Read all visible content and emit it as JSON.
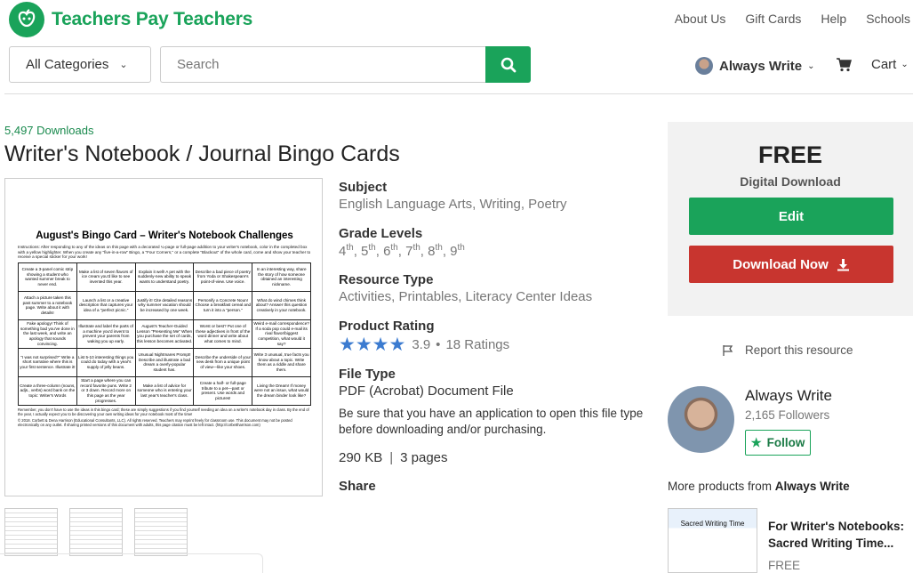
{
  "header": {
    "brand": "Teachers Pay Teachers",
    "nav": [
      "About Us",
      "Gift Cards",
      "Help",
      "Schools"
    ],
    "category_select": "All Categories",
    "search_placeholder": "Search",
    "user_name": "Always Write",
    "cart_label": "Cart"
  },
  "product": {
    "downloads": "5,497 Downloads",
    "title": "Writer's Notebook / Journal Bingo Cards",
    "subject_label": "Subject",
    "subjects": "English Language Arts, Writing, Poetry",
    "grade_label": "Grade Levels",
    "grades": [
      "4",
      "5",
      "6",
      "7",
      "8",
      "9"
    ],
    "grade_suffix": "th",
    "resource_label": "Resource Type",
    "resources": "Activities, Printables, Literacy Center Ideas",
    "rating_label": "Product Rating",
    "rating_value": "3.9",
    "rating_stars": 3.9,
    "rating_count": "18 Ratings",
    "filetype_label": "File Type",
    "filetype": "PDF (Acrobat) Document File",
    "filetype_note": "Be sure that you have an application to open this file type before downloading and/or purchasing.",
    "file_size": "290 KB",
    "pages": "3 pages",
    "share_label": "Share"
  },
  "preview_doc": {
    "title": "August's Bingo Card – Writer's Notebook Challenges",
    "intro": "Instructions: After responding to any of the ideas on this page with a decorated ¼-page or full-page addition to your writer's notebook, color in the completed box with a yellow highlighter. When you create any \"five-in-a-row\" Bingo, a \"Four Corners,\" or a complete \"Blackout\" of the whole card, come and show your teacher to receive a special sticker for your work!",
    "cells": [
      "Create a 3-panel comic strip showing a student who wanted summer break to never end.",
      "Make a list of seven flavors of ice cream you'd like to see invented this year.",
      "Explain it well! A pet with the suddenly-new ability to speak wants to understand poetry.",
      "Describe a bad piece of poetry from Yoda or Shakespeare's point-of-view. Use voice.",
      "In an interesting way, share the story of how someone obtained an interesting nickname.",
      "Attach a picture taken this past summer to a notebook page. Write about it with details!",
      "Launch a list or a creative description that captures your idea of a \"perfect picnic.\"",
      "Justify it! Cite detailed reasons why summer vacation should be increased by one week.",
      "Personify a Concrete Noun! Choose a breakfast cereal and turn it into a \"person.\"",
      "What do wind chimes think about? Answer this question creatively in your notebook.",
      "Fake apology! Think of something bad you've done in the last week, and write an apology that sounds convincing.",
      "Illustrate and label the parts of a machine you'd invent to prevent your parents from waking you up early.",
      "August's Teacher-Guided Lesson \"Presenting Me\" When you purchase the set of cards, this lesson becomes activated.",
      "Worst or best? Put one of these adjectives in front of the word dinner and write about what comes to mind.",
      "Weird e-mail correspondence? If a soda pop could e-mail its rival flavor/biggest competition, what would it say?",
      "\"I was not surprised?\" Write a short narrative where this is your first sentence. Illustrate it!",
      "List 5-10 interesting things you could do today with a year's supply of jelly beans.",
      "Unusual Nightmares Prompt! Describe and illustrate a bad dream a overly-popular student has.",
      "Describe the underside of your new desk from a unique point of view—like your shoes.",
      "Write 3 unusual, true facts you know about a topic. Write them as a riddle and share them.",
      "Create a three-column (nouns, adjs., verbs) word bank on the topic: Writer's Words",
      "Start a page where you can record favorite puns. Write 2 or 3 down. Record more on this page as the year progresses.",
      "Make a list of advice for someone who is entering your last year's teacher's class.",
      "Create a half- or full-page tribute to a pet—past or present. Use words and pictures!",
      "Living the Dream! If money were not an issue, what would the dream binder look like?"
    ],
    "note": "Remember, you don't have to use the ideas in this bingo card; these are simply suggestions if you find yourself needing an idea on a writer's notebook day in class. By the end of the year, I actually expect you to be discovering your own writing ideas for your notebook most of the time!",
    "copyright": "© 2018. Corbett & Dena Harrison (Educational Consultants, LLC). All rights reserved. Teachers may reprint freely for classroom use. This document may not be posted electronically on any outlet. If sharing printed versions of this document with adults, this page citation must be left intact. (http://corbettharrison.com)"
  },
  "buybox": {
    "price": "FREE",
    "type": "Digital Download",
    "edit_label": "Edit",
    "download_label": "Download Now"
  },
  "report_label": "Report this resource",
  "seller": {
    "name": "Always Write",
    "followers": "2,165 Followers",
    "follow_label": "Follow"
  },
  "more_products": {
    "prefix": "More products from ",
    "seller": "Always Write",
    "item_title": "For Writer's Notebooks: Sacred Writing Time...",
    "item_price": "FREE",
    "item_thumb_title": "Sacred Writing Time"
  },
  "colors": {
    "brand_green": "#1aa35a",
    "download_red": "#c8352f",
    "star_blue": "#3b7bd0"
  }
}
